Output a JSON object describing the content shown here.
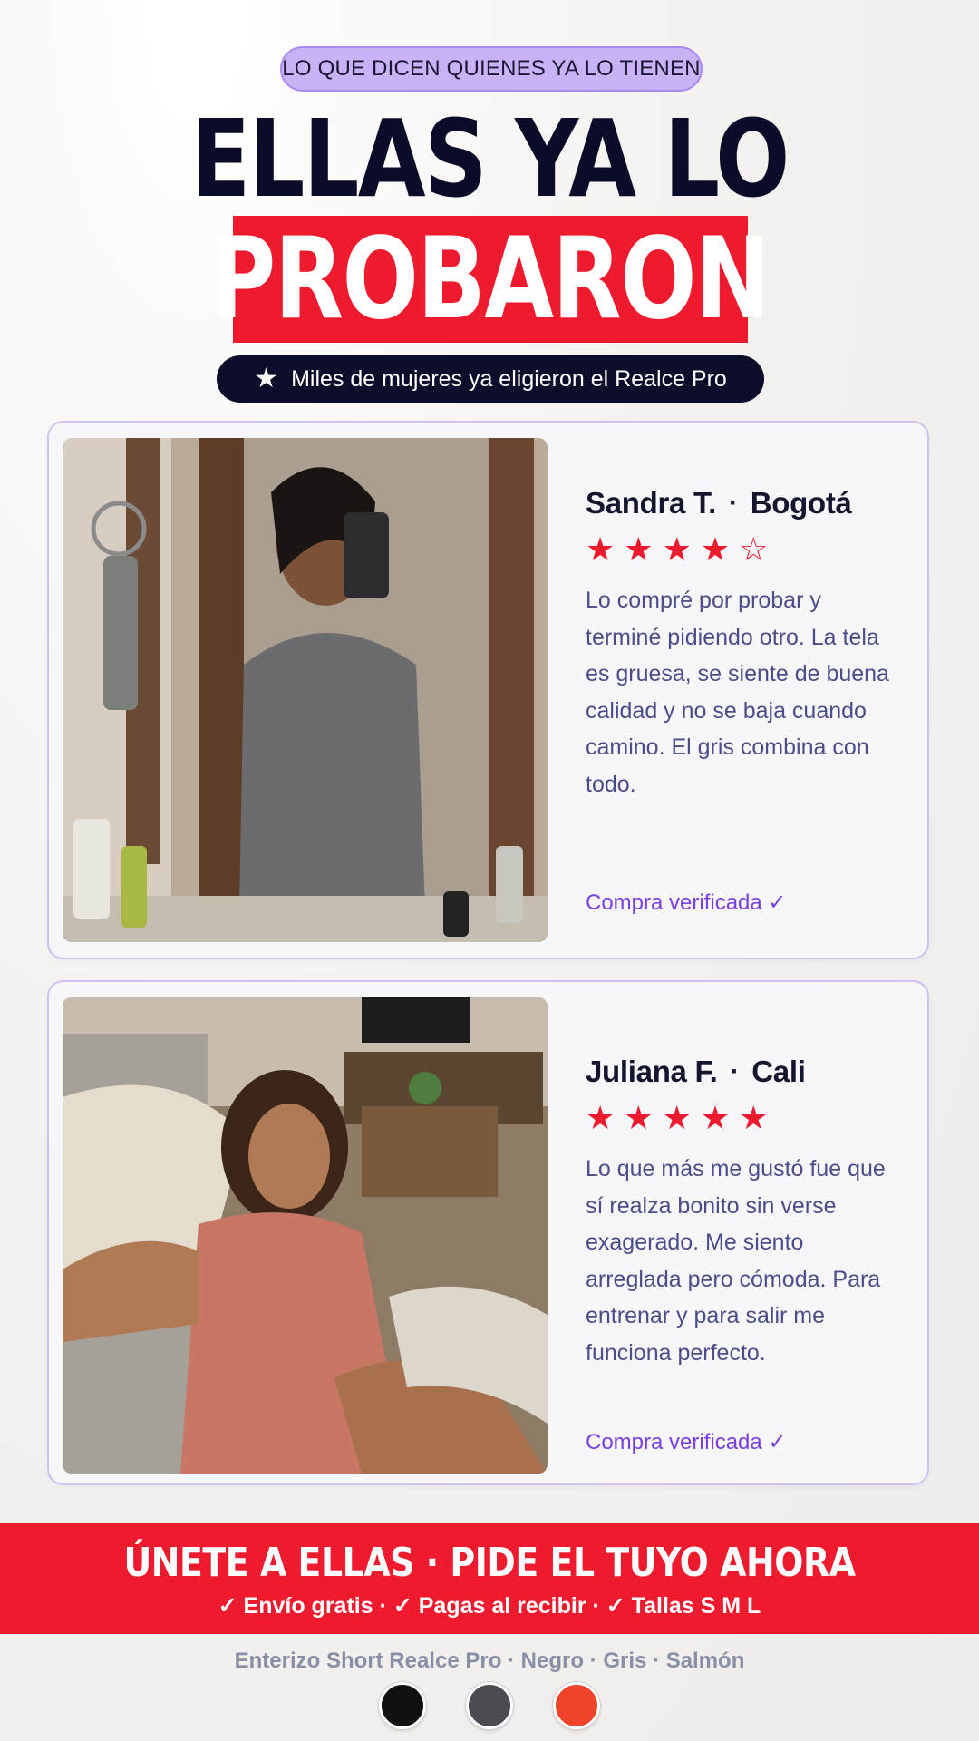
{
  "header": {
    "badge": "LO QUE DICEN QUIENES YA LO TIENEN",
    "title_line1": "ELLAS YA LO",
    "title_line2": "PROBARON",
    "tagline": "Miles de mujeres ya eligieron el Realce Pro"
  },
  "reviews": [
    {
      "name": "Sandra T.",
      "city": "Bogotá",
      "rating": 4,
      "stars": "★★★★☆",
      "text": "Lo compré por probar y terminé pidiendo otro. La tela es gruesa, se siente de buena calidad y no se baja cuando camino. El gris combina con todo.",
      "verified": "Compra verificada ✓"
    },
    {
      "name": "Juliana F.",
      "city": "Cali",
      "rating": 5,
      "stars": "★★★★★",
      "text": "Lo que más me gustó fue que sí realza bonito sin verse exagerado. Me siento arreglada pero cómoda. Para entrenar y para salir me funciona perfecto.",
      "verified": "Compra verificada ✓"
    }
  ],
  "cta": {
    "title": "ÚNETE A ELLAS · PIDE EL TUYO AHORA",
    "benefits": "✓ Envío gratis  ·  ✓ Pagas al recibir  ·  ✓ Tallas S M L"
  },
  "product": {
    "line": "Enterizo Short Realce Pro · Negro · Gris · Salmón",
    "swatches": [
      "#111111",
      "#4a4c52",
      "#f0442a"
    ]
  },
  "colors": {
    "accent_red": "#ee1b2e",
    "navy": "#0b0c2a",
    "lavender": "#c9b3f7",
    "purple_link": "#7a3fe0"
  }
}
